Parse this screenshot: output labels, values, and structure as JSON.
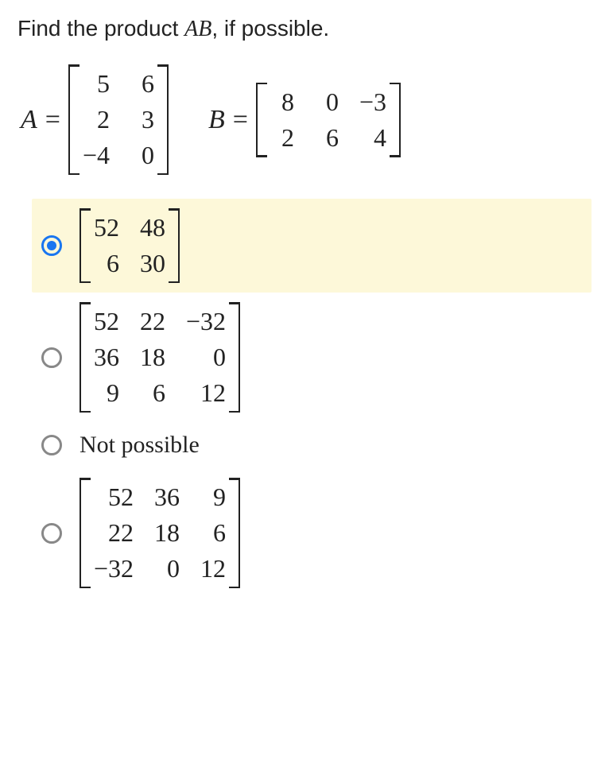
{
  "question_prefix": "Find the product ",
  "question_midA": "A",
  "question_midB": "B",
  "question_suffix": ", if possible.",
  "A_label": "A",
  "B_label": "B",
  "eq_sign": "=",
  "matrix_A": {
    "rows": 3,
    "cols": 2,
    "cells": [
      "5",
      "6",
      "2",
      "3",
      "−4",
      "0"
    ]
  },
  "matrix_B": {
    "rows": 2,
    "cols": 3,
    "cells": [
      "8",
      "0",
      "−3",
      "2",
      "6",
      "4"
    ]
  },
  "options": [
    {
      "type": "matrix",
      "selected": true,
      "matrix": {
        "rows": 2,
        "cols": 2,
        "cells": [
          "52",
          "48",
          "6",
          "30"
        ]
      }
    },
    {
      "type": "matrix",
      "selected": false,
      "matrix": {
        "rows": 3,
        "cols": 3,
        "cells": [
          "52",
          "22",
          "−32",
          "36",
          "18",
          "0",
          "9",
          "6",
          "12"
        ]
      }
    },
    {
      "type": "text",
      "selected": false,
      "text": "Not possible"
    },
    {
      "type": "matrix",
      "selected": false,
      "matrix": {
        "rows": 3,
        "cols": 3,
        "cells": [
          "52",
          "36",
          "9",
          "22",
          "18",
          "6",
          "−32",
          "0",
          "12"
        ]
      }
    }
  ]
}
